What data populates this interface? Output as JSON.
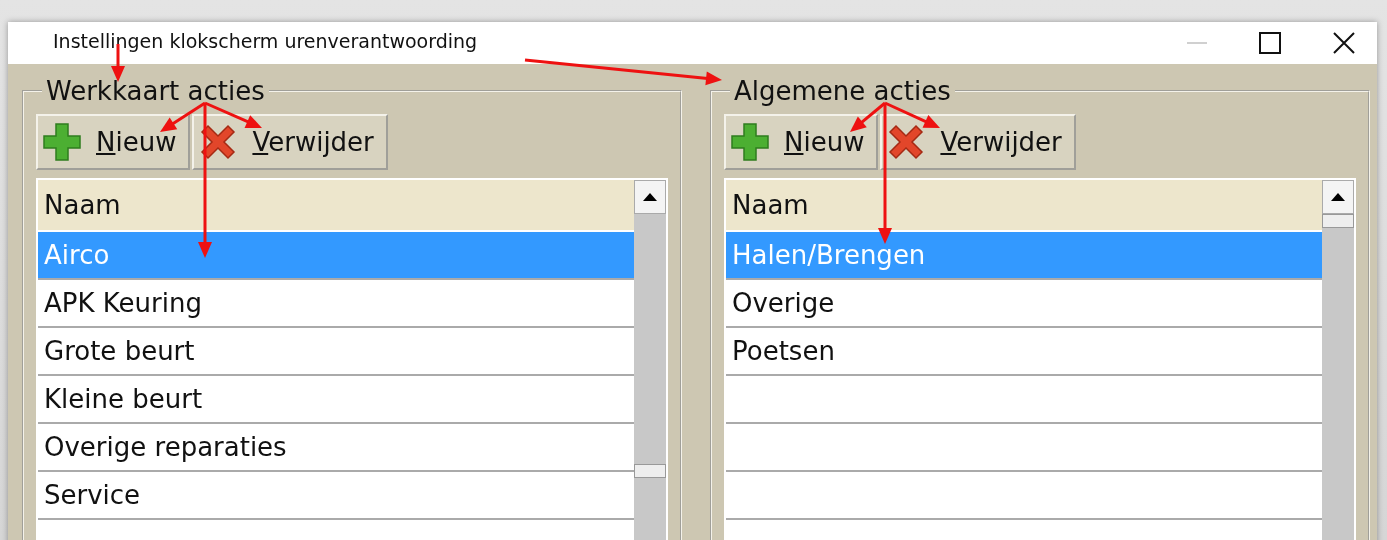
{
  "window": {
    "title": "Instellingen klokscherm urenverantwoording"
  },
  "groups": [
    {
      "title": "Werkkaart acties",
      "buttons": [
        {
          "kind": "add",
          "label": "Nieuw"
        },
        {
          "kind": "delete",
          "label": "Verwijder"
        }
      ],
      "column": "Naam",
      "rows": [
        {
          "name": "Airco",
          "selected": true
        },
        {
          "name": "APK Keuring",
          "selected": false
        },
        {
          "name": "Grote beurt",
          "selected": false
        },
        {
          "name": "Kleine beurt",
          "selected": false
        },
        {
          "name": "Overige reparaties",
          "selected": false
        },
        {
          "name": "Service",
          "selected": false
        }
      ]
    },
    {
      "title": "Algemene acties",
      "buttons": [
        {
          "kind": "add",
          "label": "Nieuw"
        },
        {
          "kind": "delete",
          "label": "Verwijder"
        }
      ],
      "column": "Naam",
      "rows": [
        {
          "name": "Halen/Brengen",
          "selected": true
        },
        {
          "name": "Overige",
          "selected": false
        },
        {
          "name": "Poetsen",
          "selected": false
        }
      ]
    }
  ]
}
